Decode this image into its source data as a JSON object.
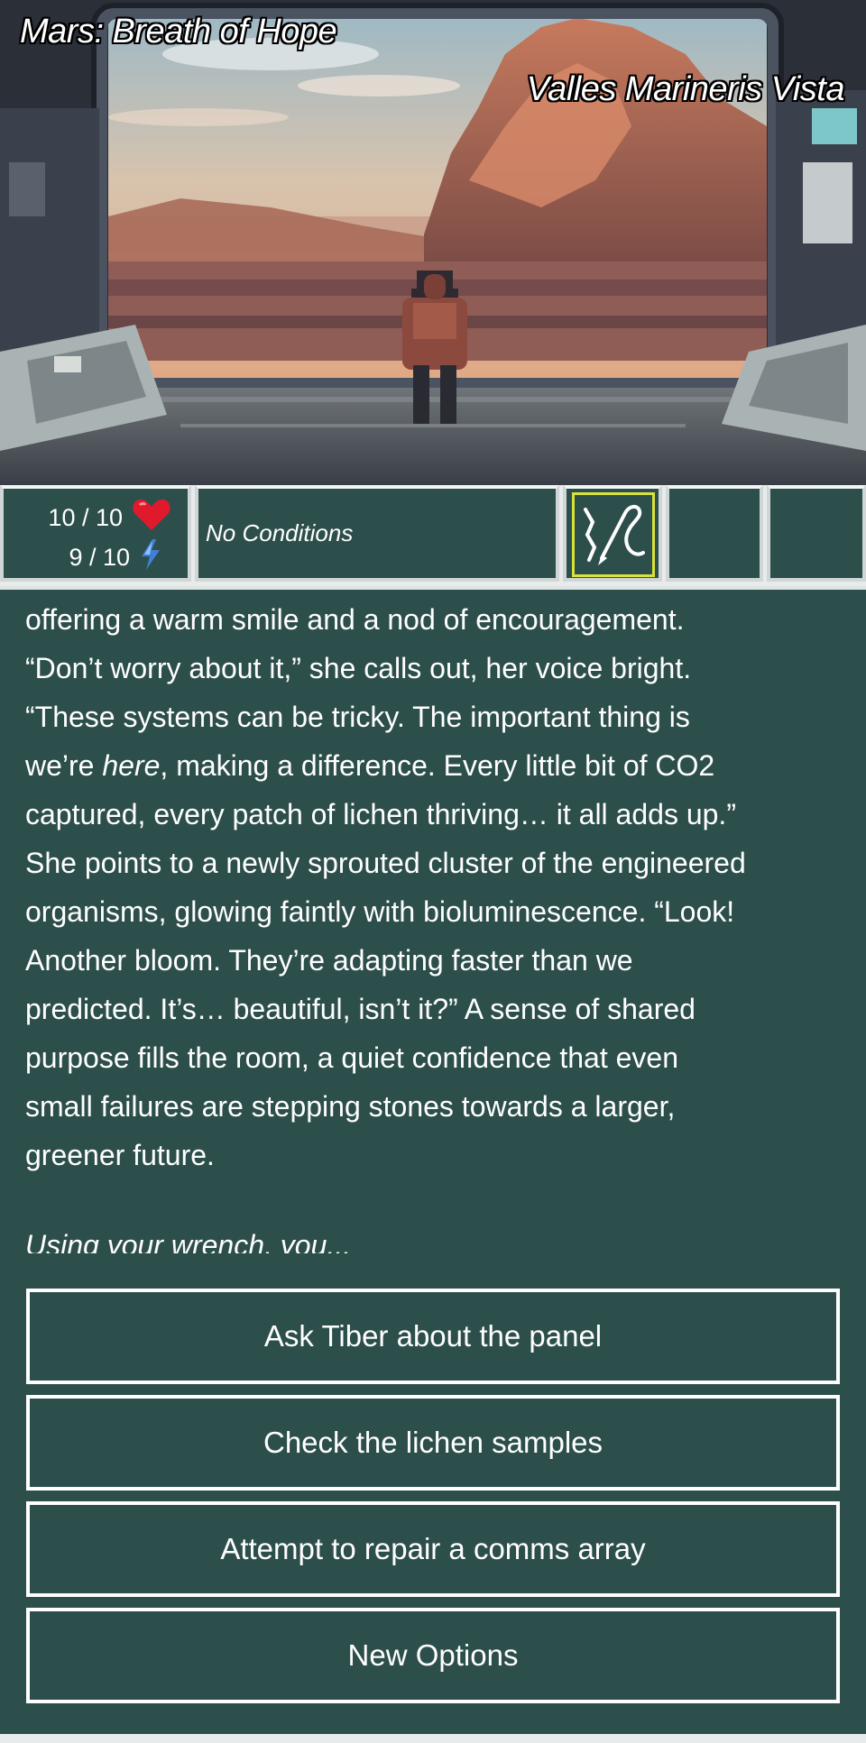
{
  "header": {
    "game_title": "Mars: Breath of Hope",
    "location": "Valles Marineris Vista"
  },
  "status": {
    "health": "10 / 10",
    "energy": "9 / 10",
    "health_icon": "heart-icon",
    "energy_icon": "lightning-icon",
    "conditions": "No Conditions",
    "selected_tool_icon": "pen-tool-icon",
    "accent_color": "#d8e23a"
  },
  "story": {
    "lines": [
      "offering a warm smile and a nod of encouragement.",
      "“Don’t worry about it,” she calls out, her voice bright.",
      "“These systems can be tricky. The important thing is",
      "captured, every patch of lichen thriving… it all adds up.”",
      "She points to a newly sprouted cluster of the engineered",
      "organisms, glowing faintly with bioluminescence. “Look!",
      "Another bloom. They’re adapting faster than we",
      "predicted. It’s… beautiful, isn’t it?” A sense of shared",
      "purpose fills the room, a quiet confidence that even",
      "small failures are stepping stones towards a larger,",
      "greener future."
    ],
    "line4_pre": "we’re ",
    "line4_em": "here",
    "line4_post": ", making a difference. Every little bit of CO2",
    "prompt": "Using your wrench, you..."
  },
  "choices": [
    "Ask Tiber about the panel",
    "Check the lichen samples",
    "Attempt to repair a comms array",
    "New Options"
  ],
  "colors": {
    "panel_bg": "#2d4f4c",
    "border": "#ffffff"
  }
}
